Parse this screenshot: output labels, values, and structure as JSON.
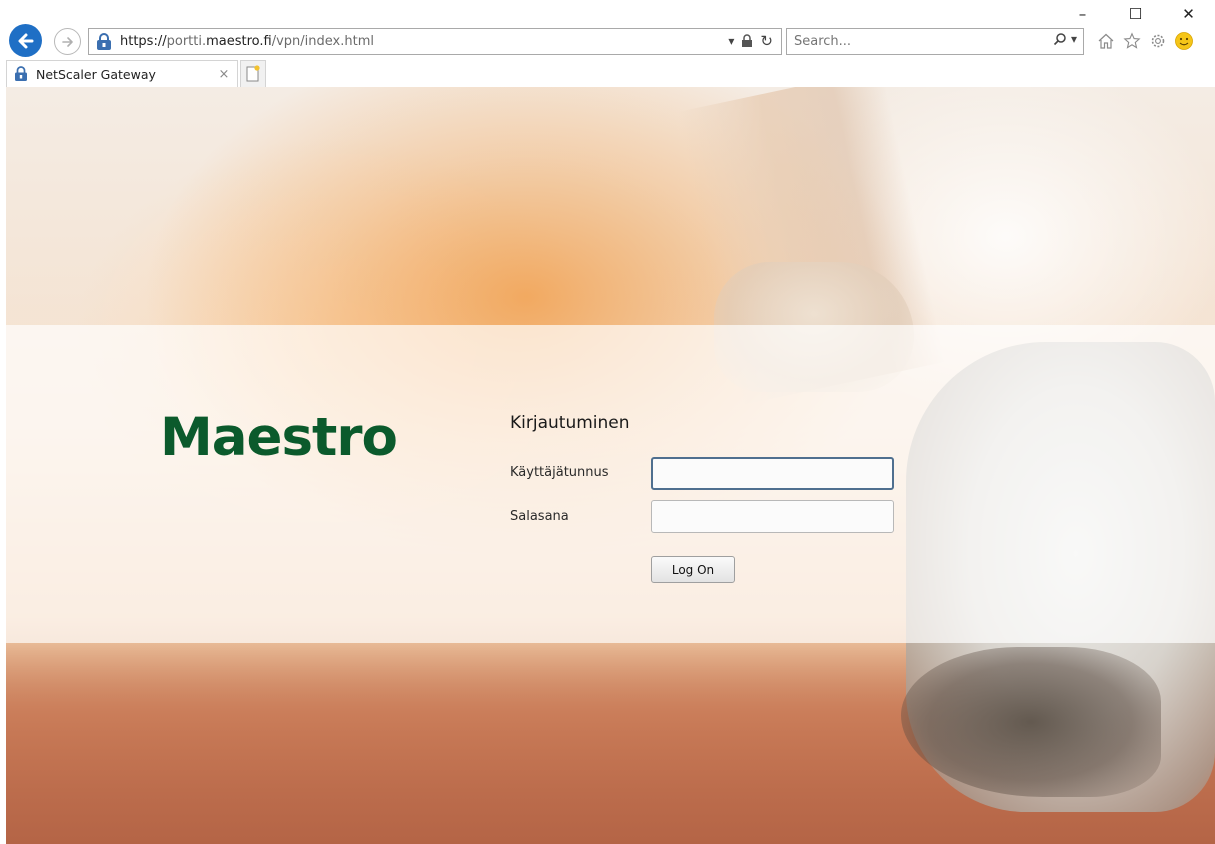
{
  "window_controls": {
    "minimize": "–",
    "maximize": "☐",
    "close": "✕"
  },
  "address_bar": {
    "url_scheme": "https://",
    "url_host_prefix": "portti.",
    "url_host_domain": "maestro.fi",
    "url_path": "/vpn/index.html",
    "dropdown_glyph": "▾",
    "refresh_glyph": "↻"
  },
  "search": {
    "placeholder": "Search...",
    "search_glyph": "⌕",
    "dropdown_glyph": "▾"
  },
  "tab": {
    "title": "NetScaler Gateway",
    "close_glyph": "×"
  },
  "icons": {
    "back": "back-arrow-icon",
    "forward": "forward-arrow-icon",
    "lock": "lock-icon",
    "home": "home-icon",
    "favorites": "star-icon",
    "settings": "gear-icon",
    "feedback": "smiley-icon",
    "new_tab": "new-tab-icon"
  },
  "colors": {
    "brand_green": "#0b5a2c",
    "back_button_blue": "#1f6fc5",
    "focus_border": "#4f6f8f"
  },
  "brand": {
    "logo_text": "Maestro"
  },
  "login": {
    "title": "Kirjautuminen",
    "username_label": "Käyttäjätunnus",
    "username_value": "",
    "password_label": "Salasana",
    "password_value": "",
    "submit_label": "Log On"
  }
}
